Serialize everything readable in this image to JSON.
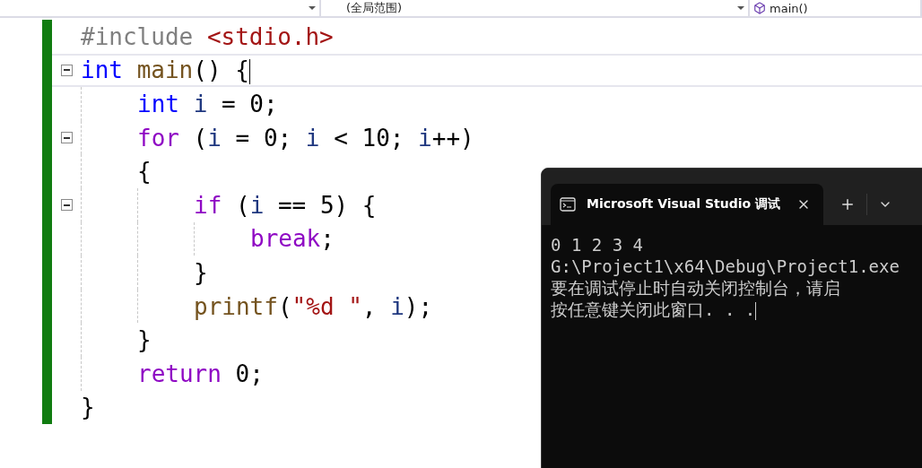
{
  "navigation_bar": {
    "scope": "(全局范围)",
    "member": "main()"
  },
  "editor": {
    "lines": [
      {
        "current": false,
        "tokens": [
          {
            "text": "#include ",
            "kind": "preproc"
          },
          {
            "text": "<stdio.h>",
            "kind": "header"
          }
        ]
      },
      {
        "current": true,
        "expanded": true,
        "tokens": [
          {
            "text": "int ",
            "kind": "type"
          },
          {
            "text": "main",
            "kind": "func"
          },
          {
            "text": "() {",
            "kind": "punct"
          }
        ],
        "children": [
          {
            "current": false,
            "tokens": [
              {
                "text": "int ",
                "kind": "type"
              },
              {
                "text": "i",
                "kind": "ident"
              },
              {
                "text": " = 0;",
                "kind": "punct"
              }
            ]
          },
          {
            "current": false,
            "expanded": true,
            "tokens": [
              {
                "text": "for",
                "kind": "control"
              },
              {
                "text": " (",
                "kind": "punct"
              },
              {
                "text": "i",
                "kind": "ident"
              },
              {
                "text": " = 0; ",
                "kind": "punct"
              },
              {
                "text": "i",
                "kind": "ident"
              },
              {
                "text": " < 10; ",
                "kind": "punct"
              },
              {
                "text": "i",
                "kind": "ident"
              },
              {
                "text": "++)",
                "kind": "punct"
              }
            ]
          },
          {
            "current": false,
            "tokens": [
              {
                "text": "{",
                "kind": "punct"
              }
            ],
            "children": [
              {
                "current": false,
                "expanded": true,
                "tokens": [
                  {
                    "text": "if",
                    "kind": "control"
                  },
                  {
                    "text": " (",
                    "kind": "punct"
                  },
                  {
                    "text": "i",
                    "kind": "ident"
                  },
                  {
                    "text": " == 5) {",
                    "kind": "punct"
                  }
                ],
                "children": [
                  {
                    "current": false,
                    "tokens": [
                      {
                        "text": "break",
                        "kind": "control"
                      },
                      {
                        "text": ";",
                        "kind": "punct"
                      }
                    ]
                  }
                ]
              },
              {
                "current": false,
                "tokens": [
                  {
                    "text": "}",
                    "kind": "punct"
                  }
                ]
              },
              {
                "current": false,
                "tokens": [
                  {
                    "text": "printf",
                    "kind": "func"
                  },
                  {
                    "text": "(",
                    "kind": "punct"
                  },
                  {
                    "text": "\"%d \"",
                    "kind": "string"
                  },
                  {
                    "text": ", ",
                    "kind": "punct"
                  },
                  {
                    "text": "i",
                    "kind": "ident"
                  },
                  {
                    "text": ");",
                    "kind": "punct"
                  }
                ]
              }
            ]
          },
          {
            "current": false,
            "tokens": [
              {
                "text": "}",
                "kind": "punct"
              }
            ]
          },
          {
            "current": false,
            "tokens": [
              {
                "text": "return",
                "kind": "control"
              },
              {
                "text": " 0;",
                "kind": "punct"
              }
            ]
          }
        ]
      },
      {
        "current": false,
        "tokens": [
          {
            "text": "}",
            "kind": "punct"
          }
        ]
      }
    ]
  },
  "console": {
    "tab_title": "Microsoft Visual Studio 调试",
    "output": [
      "0 1 2 3 4",
      "G:\\Project1\\x64\\Debug\\Project1.exe",
      "要在调试停止时自动关闭控制台，请启",
      "按任意键关闭此窗口. . ."
    ]
  }
}
